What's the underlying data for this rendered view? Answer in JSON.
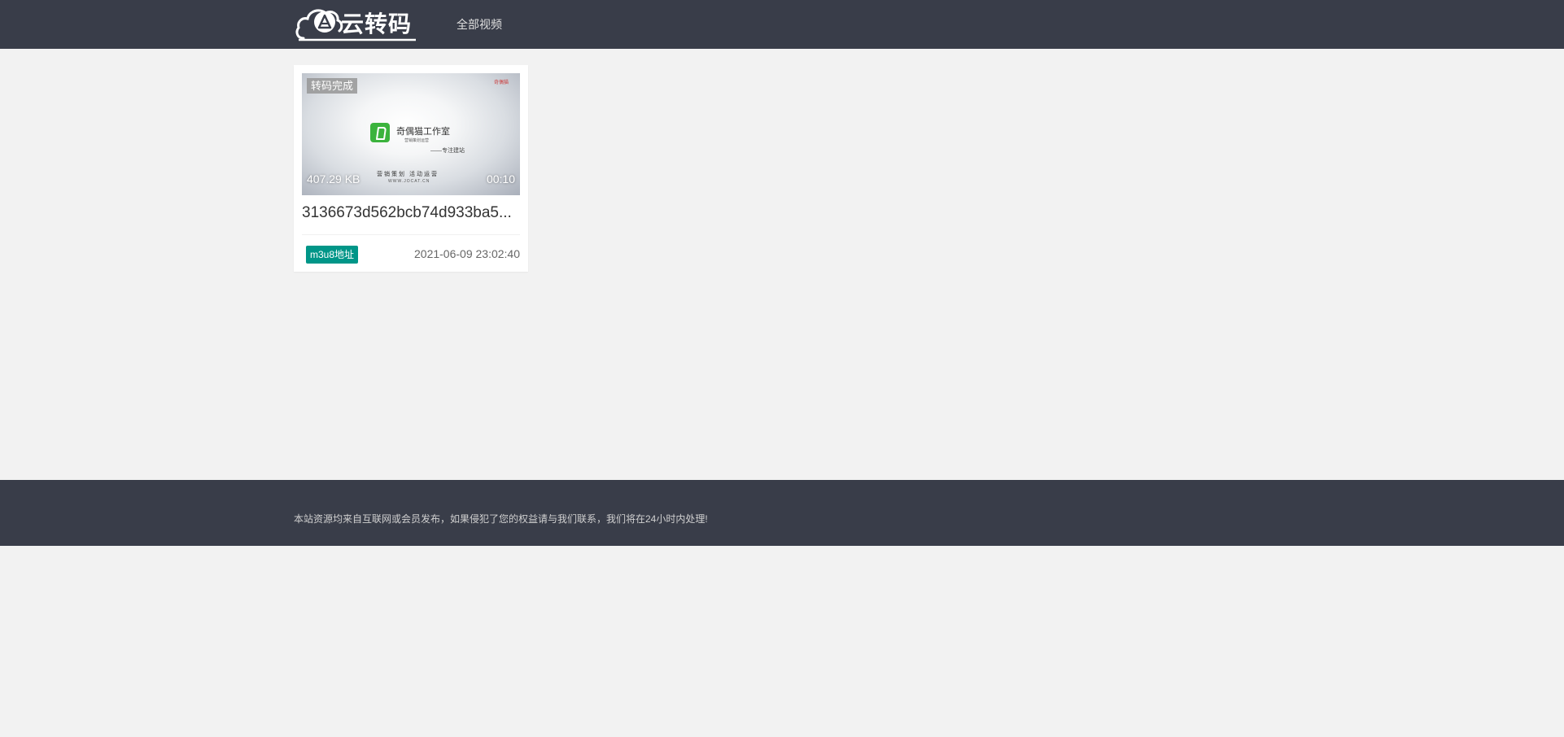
{
  "header": {
    "logo_text": "云转码",
    "nav_all_videos": "全部视频"
  },
  "videos": [
    {
      "status": "转码完成",
      "size": "407.29 KB",
      "duration": "00:10",
      "title": "3136673d562bcb74d933ba5...",
      "m3u8_label": "m3u8地址",
      "date": "2021-06-09 23:02:40",
      "thumbnail": {
        "studio_name": "奇偶猫工作室",
        "studio_sub": "营销策划运营",
        "slogan": "——专注建站",
        "bottom_line": "营销策划 活动运营",
        "url": "WWW.JOCAT.CN",
        "top_right": "奇偶猫"
      }
    }
  ],
  "footer": {
    "text": "本站资源均来自互联网或会员发布，如果侵犯了您的权益请与我们联系，我们将在24小时内处理!"
  },
  "colors": {
    "header_bg": "#393d49",
    "page_bg": "#f2f2f2",
    "accent": "#009688"
  }
}
